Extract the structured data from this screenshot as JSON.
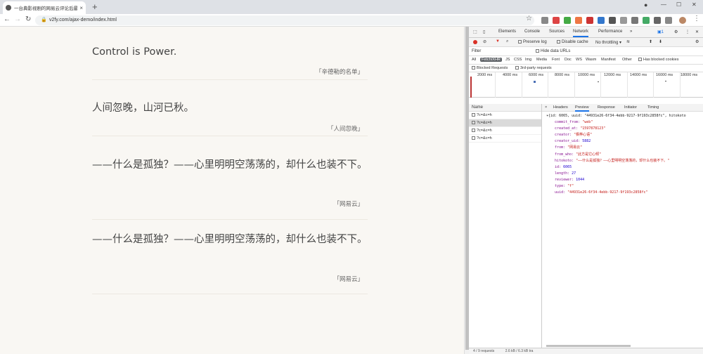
{
  "browser": {
    "tab_title": "一台典影视剧的网易云评论后最…",
    "tab_close": "×",
    "new_tab": "+",
    "url": "v2fy.com/ajax-demo/index.html"
  },
  "quotes": [
    {
      "text": "Control is Power.",
      "source": "「辛德勒的名单」"
    },
    {
      "text": "人间忽晚，山河已秋。",
      "source": "「人间忽晚」"
    },
    {
      "text": "——什么是孤独？——心里明明空荡荡的，却什么也装不下。",
      "source": "「网易云」"
    },
    {
      "text": "——什么是孤独？——心里明明空荡荡的，却什么也装不下。",
      "source": "「网易云」"
    }
  ],
  "devtools": {
    "tabs": [
      "Elements",
      "Console",
      "Sources",
      "Network",
      "Performance",
      "»"
    ],
    "preserve_log": "Preserve log",
    "disable_cache": "Disable cache",
    "throttle": "No throttling",
    "filter_label": "Filter",
    "hide_data_urls": "Hide data URLs",
    "types": [
      "All",
      "Fetch/XHR",
      "JS",
      "CSS",
      "Img",
      "Media",
      "Font",
      "Doc",
      "WS",
      "Wasm",
      "Manifest",
      "Other"
    ],
    "blocked_cookies": "Has blocked cookies",
    "blocked_requests": "Blocked Requests",
    "third_party": "3rd-party requests",
    "timeline_labels": [
      "2000 ms",
      "4000 ms",
      "6000 ms",
      "8000 ms",
      "10000 ms",
      "12000 ms",
      "14000 ms",
      "16000 ms",
      "18000 ms"
    ],
    "name_header": "Name",
    "requests": [
      "?c=&c=h",
      "?c=&c=h",
      "?c=&c=h",
      "?c=&c=h"
    ],
    "detail_tabs": [
      "×",
      "Headers",
      "Preview",
      "Response",
      "Initiator",
      "Timing"
    ],
    "status": "4 / 9 requests",
    "transferred": "2.6 kB / 6.3 kB tra",
    "json": {
      "head": "{id: 6065, uuid: \"44931e26-6f34-4ebb-9217-9f193c2858fc\", hitokoto",
      "commit_from": "\"web\"",
      "created_at": "\"1597878123\"",
      "creator": "\"枫桦心语\"",
      "creator_uid": "5882",
      "from": "\"网易云\"",
      "from_who": "\"此方是它心倾\"",
      "hitokoto": "\"——什么是孤独？——心里明明空荡荡的，却什么也装不下。\"",
      "id": "6065",
      "length": "27",
      "reviewer": "1044",
      "type": "\"f\"",
      "uuid": "\"44931e26-6f34-4ebb-9217-9f193c2858fc\""
    }
  }
}
